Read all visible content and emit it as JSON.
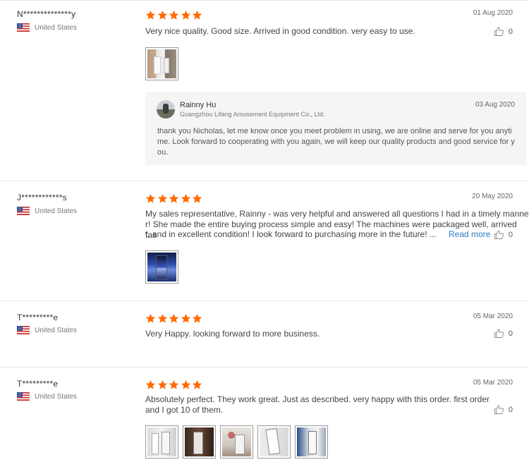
{
  "colors": {
    "star": "#ff6a00",
    "link": "#2a7bbd",
    "reply_bg": "#f5f5f5"
  },
  "icons": {
    "rating_star": "star-icon",
    "like": "thumbs-up-icon",
    "flag": "us-flag-icon"
  },
  "reviews": [
    {
      "buyer": "N**************y",
      "country": "United States",
      "rating": 5,
      "date": "01 Aug 2020",
      "text": "Very nice quality. Good size. Arrived in good condition. very easy to use.",
      "likes": "0",
      "reply": {
        "name": "Rainny Hu",
        "company": "Guangzhou Lifang Amusement Equipment Co., Ltd.",
        "date": "03 Aug 2020",
        "text": "thank you Nicholas, let me know once you meet problem in using, we are online and serve for you anytime. Look forward to cooperating with you again, we will keep our quality products and good service for you."
      }
    },
    {
      "buyer": "J************s",
      "country": "United States",
      "rating": 5,
      "date": "20 May 2020",
      "text_lines": [
        "My sales representative, Rainny - was very helpful and answered all questions I had in a timely manne",
        "r! She made the entire buying process simple and easy! The machines were packaged well, arrived fas",
        "t, and in excellent condition! I look forward to purchasing more in the future! ..."
      ],
      "read_more": "Read more",
      "likes": "0"
    },
    {
      "buyer": "T*********e",
      "country": "United States",
      "rating": 5,
      "date": "05 Mar 2020",
      "text": "Very Happy. looking forward to more business.",
      "likes": "0"
    },
    {
      "buyer": "T*********e",
      "country": "United States",
      "rating": 5,
      "date": "05 Mar 2020",
      "text_lines": [
        "Absolutely perfect. They work great. Just as described. very happy with this order. first order",
        "and I got 10 of them."
      ],
      "likes": "0"
    }
  ]
}
